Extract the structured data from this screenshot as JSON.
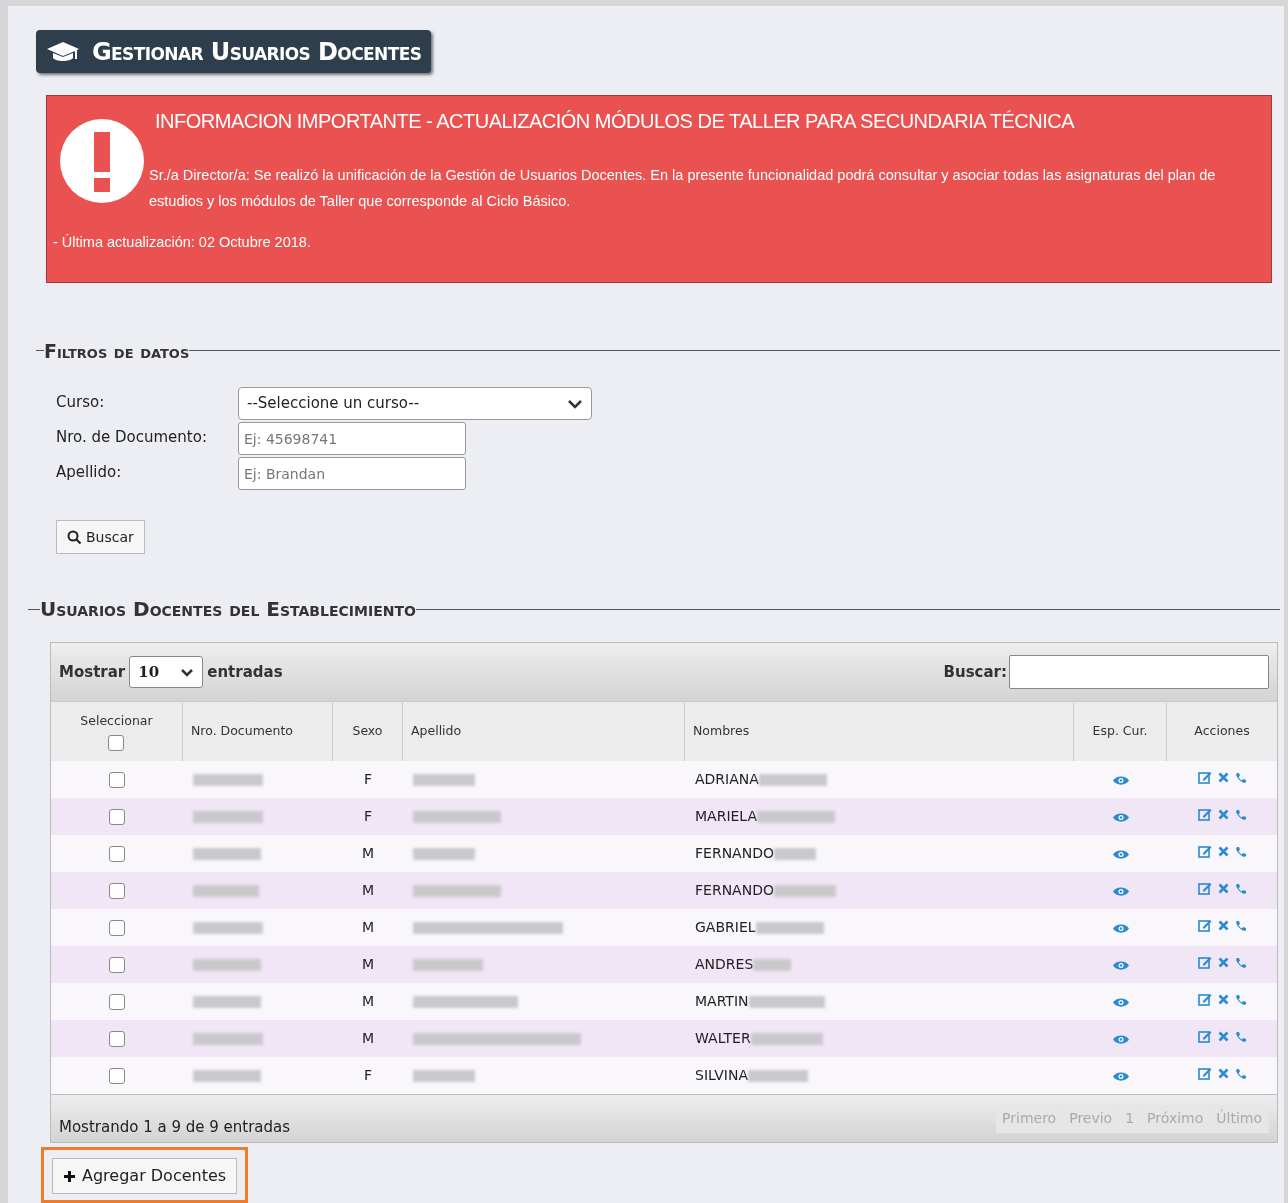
{
  "header": {
    "title": "Gestionar Usuarios Docentes"
  },
  "alert": {
    "title": "INFORMACION IMPORTANTE - ACTUALIZACIÓN MÓDULOS DE TALLER PARA SECUNDARIA TÉCNICA",
    "body": "Sr./a Director/a: Se realizó la unificación de la Gestión de Usuarios Docentes. En la presente funcionalidad podrá consultar y asociar todas las asignaturas del plan de estudios y los módulos de Taller que corresponde al Ciclo Básico.",
    "update": "- Última actualización: 02 Octubre 2018."
  },
  "filters": {
    "legend": "Filtros de datos",
    "fields": [
      {
        "kind": "select",
        "label": "Curso:",
        "value": "--Seleccione un curso--"
      },
      {
        "kind": "input",
        "label": "Nro. de Documento:",
        "placeholder": "Ej: 45698741"
      },
      {
        "kind": "input",
        "label": "Apellido:",
        "placeholder": "Ej: Brandan"
      }
    ],
    "search_button": "Buscar"
  },
  "table_section": {
    "legend": "Usuarios Docentes del Establecimiento",
    "show_label": "Mostrar",
    "page_size": "10",
    "entries_label": "entradas",
    "search_label": "Buscar:",
    "columns": [
      "Seleccionar",
      "Nro. Documento",
      "Sexo",
      "Apellido",
      "Nombres",
      "Esp. Cur.",
      "Acciones"
    ],
    "select_all_checked": false,
    "rows": [
      {
        "sexo": "F",
        "nombre": "ADRIANA",
        "checked": false
      },
      {
        "sexo": "F",
        "nombre": "MARIELA",
        "checked": false
      },
      {
        "sexo": "M",
        "nombre": "FERNANDO",
        "checked": false
      },
      {
        "sexo": "M",
        "nombre": "FERNANDO",
        "checked": false
      },
      {
        "sexo": "M",
        "nombre": "GABRIEL",
        "checked": false
      },
      {
        "sexo": "M",
        "nombre": "ANDRES",
        "checked": false
      },
      {
        "sexo": "M",
        "nombre": "MARTIN",
        "checked": false
      },
      {
        "sexo": "M",
        "nombre": "WALTER",
        "checked": false
      },
      {
        "sexo": "F",
        "nombre": "SILVINA",
        "checked": false
      }
    ],
    "info": "Mostrando 1 a 9 de 9 entradas",
    "pagination": [
      {
        "label": "Primero",
        "disabled": true
      },
      {
        "label": "Previo",
        "disabled": true
      },
      {
        "label": "1",
        "disabled": true
      },
      {
        "label": "Próximo",
        "disabled": true
      },
      {
        "label": "Último",
        "disabled": true
      }
    ]
  },
  "add_button": "Agregar Docentes"
}
